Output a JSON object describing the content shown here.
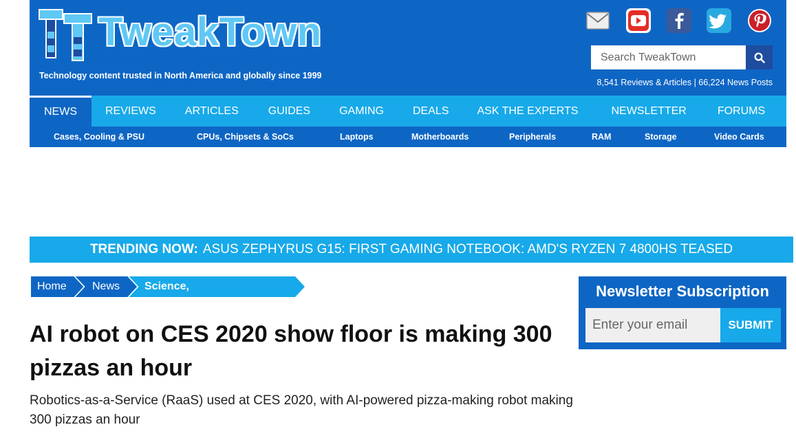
{
  "header": {
    "brand": "TweakTown",
    "tagline": "Technology content trusted in North America and globally since 1999",
    "stats": "8,541 Reviews & Articles | 66,224 News Posts",
    "search_placeholder": "Search TweakTown",
    "social_icons": [
      "mail-icon",
      "youtube-icon",
      "facebook-icon",
      "twitter-icon",
      "pinterest-icon"
    ],
    "colors": {
      "primary": "#0e66c4",
      "accent": "#17a9e9",
      "search_button": "#1e4c9f"
    }
  },
  "main_nav": [
    {
      "label": "NEWS"
    },
    {
      "label": "REVIEWS"
    },
    {
      "label": "ARTICLES"
    },
    {
      "label": "GUIDES"
    },
    {
      "label": "GAMING"
    },
    {
      "label": "DEALS"
    },
    {
      "label": "ASK THE EXPERTS"
    },
    {
      "label": "NEWSLETTER"
    },
    {
      "label": "FORUMS"
    }
  ],
  "sub_nav": [
    {
      "label": "Cases, Cooling & PSU"
    },
    {
      "label": "CPUs, Chipsets & SoCs"
    },
    {
      "label": "Laptops"
    },
    {
      "label": "Motherboards"
    },
    {
      "label": "Peripherals"
    },
    {
      "label": "RAM"
    },
    {
      "label": "Storage"
    },
    {
      "label": "Video Cards"
    }
  ],
  "trending": {
    "label": "TRENDING NOW:",
    "text": "ASUS ZEPHYRUS G15: FIRST GAMING NOTEBOOK: AMD'S RYZEN 7 4800HS TEASED"
  },
  "breadcrumb": [
    {
      "label": "Home"
    },
    {
      "label": "News"
    },
    {
      "label": "Science, Space & Robotics"
    }
  ],
  "article": {
    "title": "AI robot on CES 2020 show floor is making 300 pizzas an hour",
    "subtitle": "Robotics-as-a-Service (RaaS) used at CES 2020, with AI-powered pizza-making robot making 300 pizzas an hour"
  },
  "newsletter": {
    "title": "Newsletter Subscription",
    "placeholder": "Enter your email",
    "submit_label": "SUBMIT"
  }
}
